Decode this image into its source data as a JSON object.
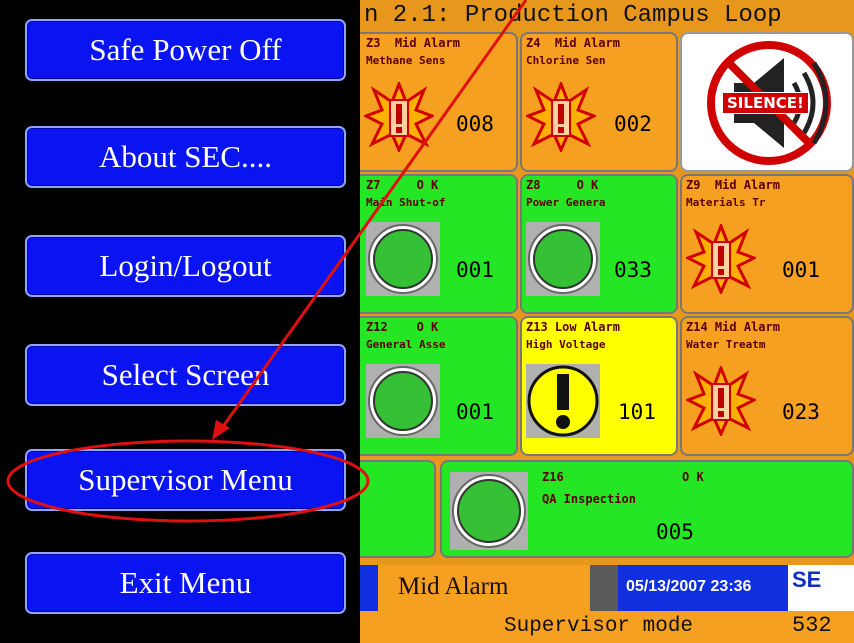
{
  "menu": {
    "buttons": [
      {
        "label": "Safe Power Off"
      },
      {
        "label": "About SEC...."
      },
      {
        "label": "Login/Logout"
      },
      {
        "label": "Select Screen"
      },
      {
        "label": "Supervisor Menu"
      },
      {
        "label": "Exit Menu"
      }
    ]
  },
  "screen": {
    "title": "n 2.1: Production Campus Loop",
    "silence_label": "SILENCE!"
  },
  "tiles": {
    "z3": {
      "id": "Z3",
      "status": "Mid Alarm",
      "name": "Methane Sens",
      "count": "008"
    },
    "z4": {
      "id": "Z4",
      "status": "Mid Alarm",
      "name": "Chlorine Sen",
      "count": "002"
    },
    "z7": {
      "id": "Z7",
      "status": "O K",
      "name": "Main Shut-of",
      "count": "001"
    },
    "z8": {
      "id": "Z8",
      "status": "O K",
      "name": "Power Genera",
      "count": "033"
    },
    "z9": {
      "id": "Z9",
      "status": "Mid Alarm",
      "name": "Materials Tr",
      "count": "001"
    },
    "z12": {
      "id": "Z12",
      "status": "O K",
      "name": "General Asse",
      "count": "001"
    },
    "z13": {
      "id": "Z13",
      "status": "Low Alarm",
      "name": "High Voltage",
      "count": "101"
    },
    "z14": {
      "id": "Z14",
      "status": "Mid Alarm",
      "name": "Water Treatm",
      "count": "023"
    },
    "z16": {
      "id": "Z16",
      "status": "O K",
      "name": "QA Inspection",
      "count": "005"
    }
  },
  "status": {
    "alarm_level": "Mid Alarm",
    "datetime": "05/13/2007 23:36",
    "logo": "SE",
    "mode": "Supervisor mode",
    "code": "532"
  },
  "colors": {
    "menu_button": "#0a14f0",
    "tile_alarm": "#f5a020",
    "tile_ok": "#25e625",
    "tile_low": "#ffff00",
    "annotation": "#e01010"
  }
}
